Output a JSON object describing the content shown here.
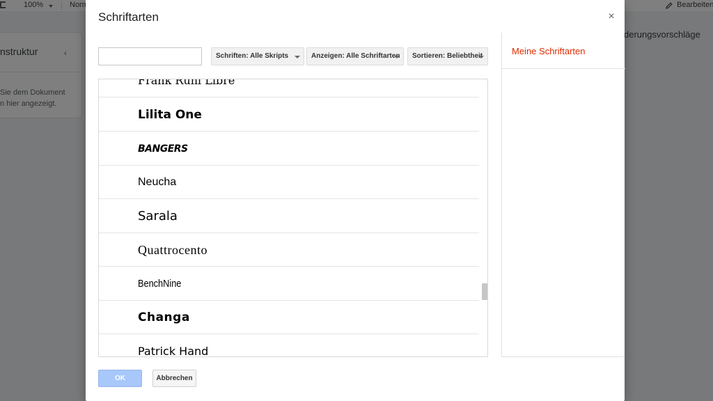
{
  "background": {
    "toolbar": {
      "zoom": "100%",
      "style": "Norm",
      "edit_mode": "Bearbeiten"
    },
    "outline": {
      "title": "nstruktur",
      "hint_line1": "Sie dem Dokument",
      "hint_line2": "n hier angezeigt."
    },
    "suggestions_label": "derungsvorschläge"
  },
  "dialog": {
    "title": "Schriftarten",
    "close_symbol": "×",
    "search": {
      "value": "",
      "placeholder": ""
    },
    "filters": {
      "scripts": "Schriften: Alle Skripts",
      "show": "Anzeigen: Alle Schriftarten",
      "sort": "Sortieren: Beliebtheit"
    },
    "fonts": [
      {
        "name": "Frank Ruhl Libre"
      },
      {
        "name": "Lilita One"
      },
      {
        "name": "BANGERS"
      },
      {
        "name": "Neucha"
      },
      {
        "name": "Sarala"
      },
      {
        "name": "Quattrocento"
      },
      {
        "name": "BenchNine"
      },
      {
        "name": "Changa"
      },
      {
        "name": "Patrick Hand"
      }
    ],
    "my_fonts_title": "Meine Schriftarten",
    "ok_label": "OK",
    "cancel_label": "Abbrechen"
  },
  "colors": {
    "my_fonts_accent": "#dd2c00",
    "ok_button": "#a8c7fa"
  }
}
